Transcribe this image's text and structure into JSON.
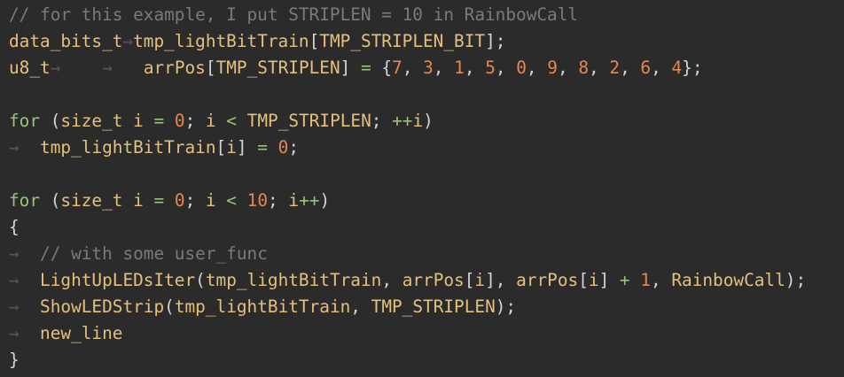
{
  "editor": {
    "colors": {
      "background": "#2b2b2b",
      "comment": "#7a7a7a",
      "identifier": "#e5c07b",
      "keyword": "#98c379",
      "number": "#e5884f",
      "punctuation": "#d4d4d4",
      "whitespace_marker": "#555555"
    },
    "lines": [
      [
        {
          "t": "// for this example, I put STRIPLEN = 10 in RainbowCall",
          "k": "comment"
        }
      ],
      [
        {
          "t": "data_bits_t",
          "k": "type"
        },
        {
          "t": "→",
          "k": "ws"
        },
        {
          "t": "tmp_lightBitTrain",
          "k": "ident"
        },
        {
          "t": "[",
          "k": "punct"
        },
        {
          "t": "TMP_STRIPLEN_BIT",
          "k": "ident"
        },
        {
          "t": "];",
          "k": "punct"
        }
      ],
      [
        {
          "t": "u8_t",
          "k": "type"
        },
        {
          "t": "→",
          "k": "ws"
        },
        {
          "t": "    ",
          "k": "plain"
        },
        {
          "t": "→",
          "k": "ws"
        },
        {
          "t": "   ",
          "k": "plain"
        },
        {
          "t": "arrPos",
          "k": "ident"
        },
        {
          "t": "[",
          "k": "punct"
        },
        {
          "t": "TMP_STRIPLEN",
          "k": "ident"
        },
        {
          "t": "] ",
          "k": "punct"
        },
        {
          "t": "=",
          "k": "operator"
        },
        {
          "t": " {",
          "k": "punct"
        },
        {
          "t": "7",
          "k": "number"
        },
        {
          "t": ", ",
          "k": "punct"
        },
        {
          "t": "3",
          "k": "number"
        },
        {
          "t": ", ",
          "k": "punct"
        },
        {
          "t": "1",
          "k": "number"
        },
        {
          "t": ", ",
          "k": "punct"
        },
        {
          "t": "5",
          "k": "number"
        },
        {
          "t": ", ",
          "k": "punct"
        },
        {
          "t": "0",
          "k": "number"
        },
        {
          "t": ", ",
          "k": "punct"
        },
        {
          "t": "9",
          "k": "number"
        },
        {
          "t": ", ",
          "k": "punct"
        },
        {
          "t": "8",
          "k": "number"
        },
        {
          "t": ", ",
          "k": "punct"
        },
        {
          "t": "2",
          "k": "number"
        },
        {
          "t": ", ",
          "k": "punct"
        },
        {
          "t": "6",
          "k": "number"
        },
        {
          "t": ", ",
          "k": "punct"
        },
        {
          "t": "4",
          "k": "number"
        },
        {
          "t": "};",
          "k": "punct"
        }
      ],
      [],
      [
        {
          "t": "for",
          "k": "keyword"
        },
        {
          "t": " (",
          "k": "punct"
        },
        {
          "t": "size_t",
          "k": "type"
        },
        {
          "t": " ",
          "k": "plain"
        },
        {
          "t": "i",
          "k": "ident"
        },
        {
          "t": " ",
          "k": "plain"
        },
        {
          "t": "=",
          "k": "operator"
        },
        {
          "t": " ",
          "k": "plain"
        },
        {
          "t": "0",
          "k": "number"
        },
        {
          "t": "; ",
          "k": "punct"
        },
        {
          "t": "i",
          "k": "ident"
        },
        {
          "t": " ",
          "k": "plain"
        },
        {
          "t": "<",
          "k": "operator"
        },
        {
          "t": " ",
          "k": "plain"
        },
        {
          "t": "TMP_STRIPLEN",
          "k": "ident"
        },
        {
          "t": "; ",
          "k": "punct"
        },
        {
          "t": "++",
          "k": "operator"
        },
        {
          "t": "i",
          "k": "ident"
        },
        {
          "t": ")",
          "k": "punct"
        }
      ],
      [
        {
          "t": "→",
          "k": "ws"
        },
        {
          "t": "  ",
          "k": "plain"
        },
        {
          "t": "tmp_lightBitTrain",
          "k": "ident"
        },
        {
          "t": "[",
          "k": "punct"
        },
        {
          "t": "i",
          "k": "ident"
        },
        {
          "t": "] ",
          "k": "punct"
        },
        {
          "t": "=",
          "k": "operator"
        },
        {
          "t": " ",
          "k": "plain"
        },
        {
          "t": "0",
          "k": "number"
        },
        {
          "t": ";",
          "k": "punct"
        }
      ],
      [],
      [
        {
          "t": "for",
          "k": "keyword"
        },
        {
          "t": " (",
          "k": "punct"
        },
        {
          "t": "size_t",
          "k": "type"
        },
        {
          "t": " ",
          "k": "plain"
        },
        {
          "t": "i",
          "k": "ident"
        },
        {
          "t": " ",
          "k": "plain"
        },
        {
          "t": "=",
          "k": "operator"
        },
        {
          "t": " ",
          "k": "plain"
        },
        {
          "t": "0",
          "k": "number"
        },
        {
          "t": "; ",
          "k": "punct"
        },
        {
          "t": "i",
          "k": "ident"
        },
        {
          "t": " ",
          "k": "plain"
        },
        {
          "t": "<",
          "k": "operator"
        },
        {
          "t": " ",
          "k": "plain"
        },
        {
          "t": "10",
          "k": "number"
        },
        {
          "t": "; ",
          "k": "punct"
        },
        {
          "t": "i",
          "k": "ident"
        },
        {
          "t": "++",
          "k": "operator"
        },
        {
          "t": ")",
          "k": "punct"
        }
      ],
      [
        {
          "t": "{",
          "k": "punct"
        }
      ],
      [
        {
          "t": "→",
          "k": "ws"
        },
        {
          "t": "  ",
          "k": "plain"
        },
        {
          "t": "// with some user_func",
          "k": "comment"
        }
      ],
      [
        {
          "t": "→",
          "k": "ws"
        },
        {
          "t": "  ",
          "k": "plain"
        },
        {
          "t": "LightUpLEDsIter",
          "k": "func"
        },
        {
          "t": "(",
          "k": "punct"
        },
        {
          "t": "tmp_lightBitTrain",
          "k": "ident"
        },
        {
          "t": ", ",
          "k": "punct"
        },
        {
          "t": "arrPos",
          "k": "ident"
        },
        {
          "t": "[",
          "k": "punct"
        },
        {
          "t": "i",
          "k": "ident"
        },
        {
          "t": "], ",
          "k": "punct"
        },
        {
          "t": "arrPos",
          "k": "ident"
        },
        {
          "t": "[",
          "k": "punct"
        },
        {
          "t": "i",
          "k": "ident"
        },
        {
          "t": "] ",
          "k": "punct"
        },
        {
          "t": "+",
          "k": "operator"
        },
        {
          "t": " ",
          "k": "plain"
        },
        {
          "t": "1",
          "k": "number"
        },
        {
          "t": ", ",
          "k": "punct"
        },
        {
          "t": "RainbowCall",
          "k": "ident"
        },
        {
          "t": ");",
          "k": "punct"
        }
      ],
      [
        {
          "t": "→",
          "k": "ws"
        },
        {
          "t": "  ",
          "k": "plain"
        },
        {
          "t": "ShowLEDStrip",
          "k": "func"
        },
        {
          "t": "(",
          "k": "punct"
        },
        {
          "t": "tmp_lightBitTrain",
          "k": "ident"
        },
        {
          "t": ", ",
          "k": "punct"
        },
        {
          "t": "TMP_STRIPLEN",
          "k": "ident"
        },
        {
          "t": ");",
          "k": "punct"
        }
      ],
      [
        {
          "t": "→",
          "k": "ws"
        },
        {
          "t": "  ",
          "k": "plain"
        },
        {
          "t": "new_line",
          "k": "ident"
        }
      ],
      [
        {
          "t": "}",
          "k": "punct"
        }
      ]
    ]
  }
}
